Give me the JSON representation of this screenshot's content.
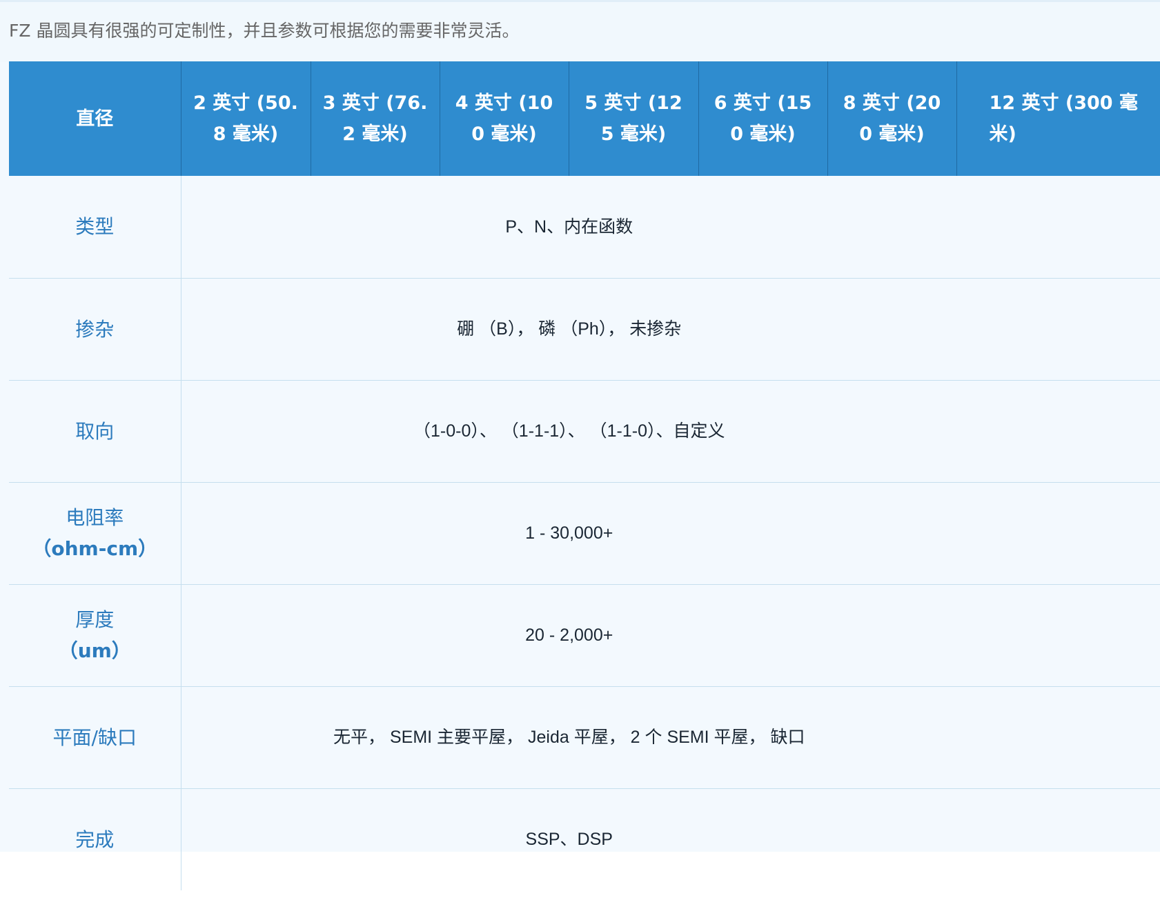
{
  "intro": {
    "text": "FZ 晶圆具有很强的可定制性，并且参数可根据您的需要非常灵活。"
  },
  "table": {
    "header": {
      "first": "直径",
      "sizes": [
        "2 英寸 (50.8 毫米)",
        "3 英寸 (76.2 毫米)",
        "4 英寸 (100 毫米)",
        "5 英寸 (125 毫米)",
        "6 英寸 (150 毫米)",
        "8 英寸 (200 毫米)",
        "12 英寸 (300 毫米)"
      ]
    },
    "rows": [
      {
        "label": "类型",
        "unit": "",
        "value": "P、N、内在函数"
      },
      {
        "label": "掺杂",
        "unit": "",
        "value": "硼 （B）， 磷 （Ph）， 未掺杂"
      },
      {
        "label": "取向",
        "unit": "",
        "value": "（1-0-0）、 （1-1-1）、 （1-1-0）、自定义"
      },
      {
        "label": "电阻率",
        "unit": "（ohm-cm）",
        "value": "1 - 30,000+"
      },
      {
        "label": "厚度",
        "unit": "（um）",
        "value": "20 - 2,000+"
      },
      {
        "label": "平面/缺口",
        "unit": "",
        "value": "无平， SEMI 主要平屋， Jeida 平屋， 2 个 SEMI 平屋， 缺口"
      },
      {
        "label": "完成",
        "unit": "",
        "value": "SSP、DSP"
      }
    ]
  }
}
